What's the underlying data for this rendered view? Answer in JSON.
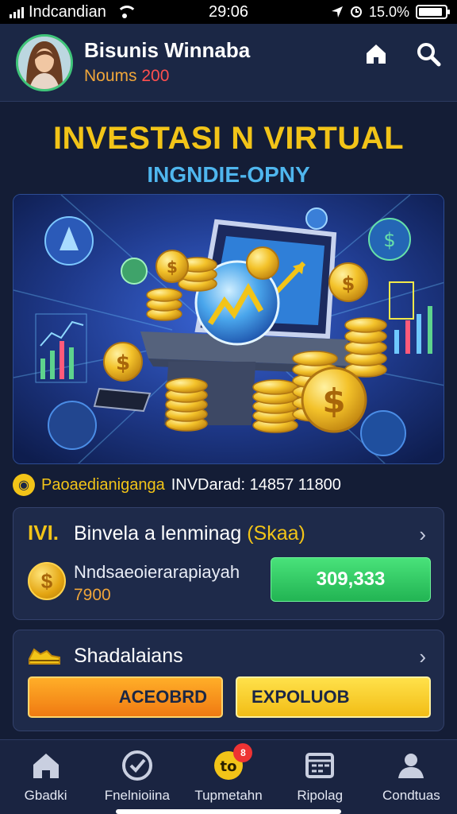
{
  "status_bar": {
    "carrier": "Indcandian",
    "time": "29:06",
    "battery": "15.0%",
    "battery_level": 0.9
  },
  "header": {
    "user_name": "Bisunis Winnaba",
    "sub_label": "Noums",
    "sub_value": "200",
    "home_icon": "home-icon",
    "search_icon": "search-icon"
  },
  "headline": {
    "title": "INVESTASI N VIRTUAL",
    "subtitle": "INGNDIE-OPNY"
  },
  "ticker": {
    "label": "Paoaedianiganga",
    "value": "INVDarad: 14857 11800"
  },
  "card1": {
    "icon_text": "IVI.",
    "title": "Binvela a lenminag",
    "title_accent": "(Skaa)",
    "description": "Nndsaeoierarapiayah",
    "amount": "7900",
    "button": "309,333"
  },
  "card2": {
    "title": "Shadalaians",
    "button_left": "ACEOBRD",
    "button_right": "EXPOLUOB"
  },
  "nav": [
    {
      "label": "Gbadki",
      "icon": "home-icon"
    },
    {
      "label": "Fnelnioiina",
      "icon": "compass-icon"
    },
    {
      "label": "Tupmetahn",
      "icon": "coin-icon",
      "badge": "8"
    },
    {
      "label": "Ripolag",
      "icon": "calendar-icon"
    },
    {
      "label": "Condtuas",
      "icon": "user-icon"
    }
  ],
  "colors": {
    "accent_yellow": "#f2c418",
    "accent_blue": "#4fb6ee",
    "accent_green": "#22b453",
    "accent_orange": "#f07a12",
    "background": "#141d36"
  }
}
